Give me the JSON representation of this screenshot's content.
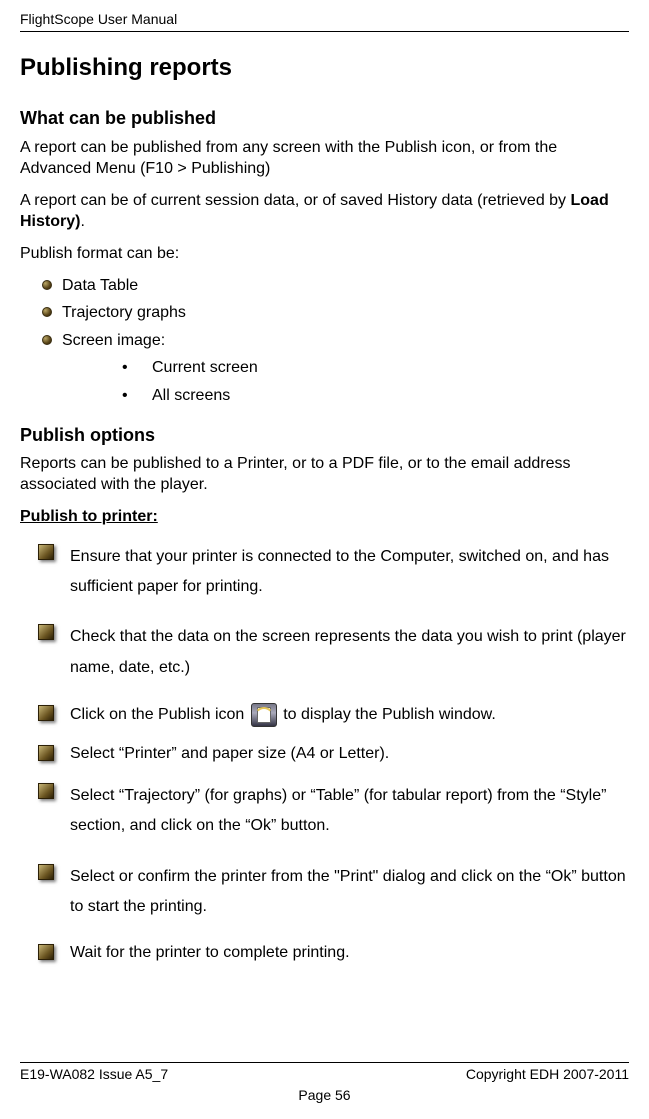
{
  "header": {
    "title": "FlightScope User Manual"
  },
  "h1": "Publishing reports",
  "sec1": {
    "heading": "What can be published",
    "p1a": "A report can be published from any screen with the Publish icon, or from the Advanced Menu (F10 > Publishing)",
    "p2a": "A report can be of current session data, or of saved History data (retrieved by ",
    "p2b": "Load History)",
    "p2c": ".",
    "p3": "Publish format can be:",
    "formats": {
      "0": "Data Table",
      "1": "Trajectory graphs",
      "2": "Screen image:"
    },
    "sub": {
      "0": "Current screen",
      "1": "All screens"
    }
  },
  "sec2": {
    "heading": "Publish options",
    "p1": "Reports can be published to a Printer, or to a PDF file, or to the email address associated with the player.",
    "sub": "Publish to printer:",
    "steps": {
      "0": "Ensure that your printer is connected to the Computer, switched on, and has sufficient paper for printing.",
      "1": "Check that the data on the screen represents the data you wish to print (player name, date, etc.)",
      "2a": "Click on the Publish icon ",
      "2b": " to display the Publish window.",
      "3": "Select “Printer” and paper size (A4 or Letter).",
      "4": "Select “Trajectory” (for graphs) or “Table” (for tabular report) from the “Style” section, and click on the “Ok” button.",
      "5": "Select or confirm the printer from the \"Print\" dialog and click on the “Ok” button to start the printing.",
      "6": "Wait for the printer to complete printing."
    }
  },
  "footer": {
    "left": "E19-WA082 Issue A5_7",
    "right": "Copyright EDH 2007-2011",
    "page": "Page 56"
  }
}
